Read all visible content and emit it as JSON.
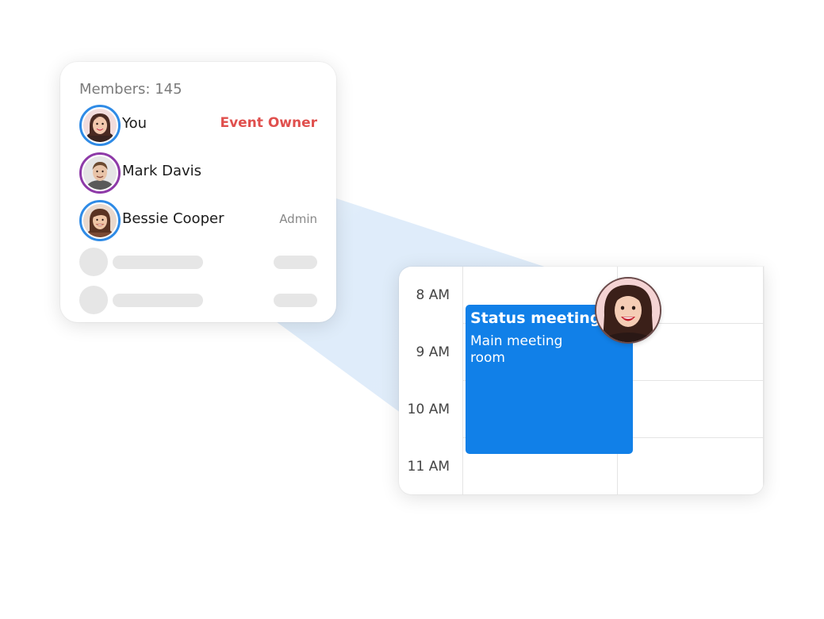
{
  "members": {
    "title": "Members: 145",
    "list": [
      {
        "name": "You",
        "role": "Event Owner",
        "avatar_icon": "woman-smiling-avatar-icon",
        "ring_color": "#2f8be6"
      },
      {
        "name": "Mark Davis",
        "role": "",
        "avatar_icon": "man-avatar-icon",
        "ring_color": "#8e3aa8"
      },
      {
        "name": "Bessie Cooper",
        "role": "Admin",
        "avatar_icon": "woman-avatar-icon",
        "ring_color": "#2f8be6"
      }
    ],
    "owner_color": "#e0504e"
  },
  "calendar": {
    "times": [
      "8 AM",
      "9 AM",
      "10 AM",
      "11 AM"
    ],
    "event": {
      "title": "Status meeting",
      "location": "Main meeting room",
      "color": "#1180e8",
      "attendee_icon": "woman-smiling-avatar-icon"
    }
  }
}
